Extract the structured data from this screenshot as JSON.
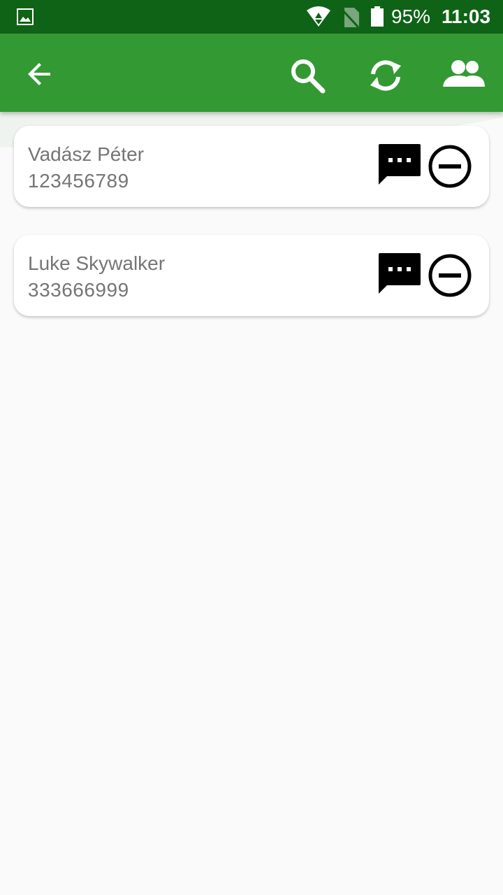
{
  "status_bar": {
    "battery_percent": "95%",
    "time": "11:03",
    "icons": [
      "gallery-icon",
      "wifi-icon",
      "no-sim-icon",
      "battery-icon"
    ]
  },
  "app_bar": {
    "color": "#339933",
    "icons": [
      "back-arrow-icon",
      "search-icon",
      "sync-icon",
      "contacts-icon"
    ]
  },
  "contacts": [
    {
      "name": "Vadász Péter",
      "phone": "123456789"
    },
    {
      "name": "Luke Skywalker",
      "phone": "333666999"
    }
  ]
}
